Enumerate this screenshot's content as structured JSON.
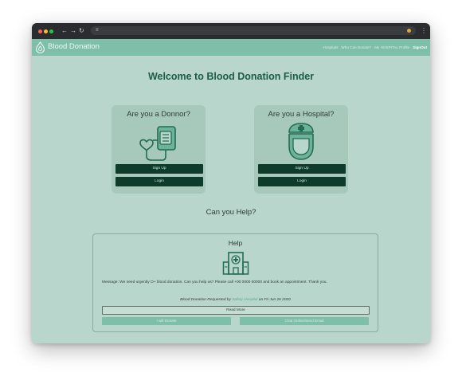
{
  "browser": {
    "back_glyph": "←",
    "forward_glyph": "→",
    "reload_glyph": "↻",
    "menu_glyph": "⋮"
  },
  "nav": {
    "brand": "Blood Donation",
    "links": [
      "Hospitals",
      "Who Can Donate?",
      "My HOSPITAL Profile",
      "SignOut"
    ]
  },
  "page": {
    "title": "Welcome to Blood Donation Finder",
    "donor_card": {
      "title": "Are you a Donnor?",
      "signup": "Sign Up",
      "login": "Login"
    },
    "hospital_card": {
      "title": "Are you a Hospital?",
      "signup": "Sign Up",
      "login": "Login"
    },
    "help_question": "Can you Help?"
  },
  "help": {
    "title": "Help",
    "message": "Message: We need urgently O+ blood donation. Can you help us? Please call +00 0000 00000 and book an appointment. Thank you.",
    "requested_prefix": "Blood Donation Requested by",
    "hospital": "Safety Hospital",
    "requested_on": "on Fri Jun 26 2020",
    "read_more": "Read More",
    "donate_btn": "I will Donate",
    "chat_btn": "Chat Online/Send Email"
  },
  "colors": {
    "page_bg": "#b8d6cb",
    "navbar": "#7dbfa8",
    "button_dark": "#0e3b2b",
    "heading": "#1c5c48",
    "icon_green": "#2e8b6f"
  }
}
